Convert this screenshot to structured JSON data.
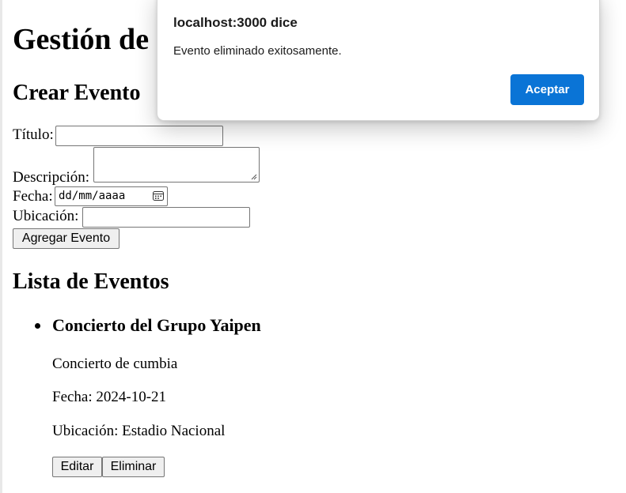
{
  "page": {
    "heading": "Gestión de Eventos",
    "create_heading": "Crear Evento",
    "list_heading": "Lista de Eventos"
  },
  "form": {
    "title_label": "Título:",
    "title_value": "",
    "description_label": "Descripción:",
    "description_value": "",
    "date_label": "Fecha:",
    "date_placeholder": "dd/mm/aaaa",
    "location_label": "Ubicación:",
    "location_value": "",
    "submit_label": "Agregar Evento"
  },
  "events": [
    {
      "title": "Concierto del Grupo Yaipen",
      "description": "Concierto de cumbia",
      "date_text": "Fecha: 2024-10-21",
      "location_text": "Ubicación: Estadio Nacional",
      "edit_label": "Editar",
      "delete_label": "Eliminar"
    }
  ],
  "dialog": {
    "title": "localhost:3000 dice",
    "message": "Evento eliminado exitosamente.",
    "ok_label": "Aceptar",
    "ok_color": "#0a74d6"
  },
  "icons": {
    "date_picker": "calendar-icon",
    "list_bullet": "bullet-icon"
  }
}
